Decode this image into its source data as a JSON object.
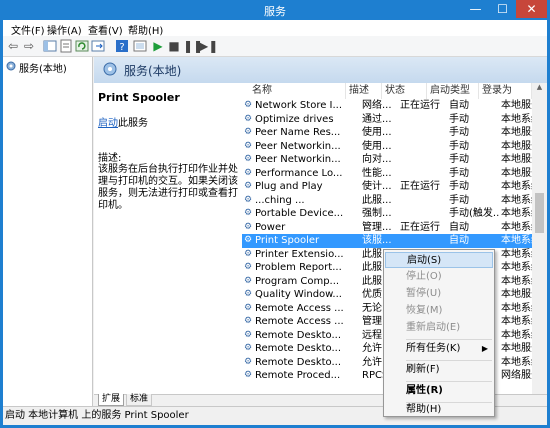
{
  "window": {
    "title": "服务",
    "minimize": "—",
    "maximize": "☐",
    "close": "✕"
  },
  "menubar": {
    "items": [
      "文件(F)",
      "操作(A)",
      "查看(V)",
      "帮助(H)"
    ]
  },
  "toolbar": {
    "icons": [
      "back-icon",
      "forward-icon",
      "console-tree-icon",
      "properties-icon",
      "refresh-icon",
      "export-icon",
      "help-icon",
      "console-icon",
      "play-icon",
      "stop-icon",
      "pause-icon",
      "resume-icon"
    ]
  },
  "tree": {
    "root": "服务(本地)"
  },
  "panel": {
    "header": "服务(本地)"
  },
  "details": {
    "service_name": "Print Spooler",
    "start_link": "启动",
    "start_suffix": "此服务",
    "desc_label": "描述:",
    "desc_text": "该服务在后台执行打印作业并处理与打印机的交互。如果关闭该服务，则无法进行打印或查看打印机。"
  },
  "columns": [
    "名称",
    "描述",
    "状态",
    "启动类型",
    "登录为"
  ],
  "rows": [
    [
      "Network Store I...",
      "网络...",
      "正在运行",
      "自动",
      "本地服务"
    ],
    [
      "Optimize drives",
      "通过...",
      "",
      "手动",
      "本地系统"
    ],
    [
      "Peer Name Res...",
      "使用...",
      "",
      "手动",
      "本地服务"
    ],
    [
      "Peer Networkin...",
      "使用...",
      "",
      "手动",
      "本地服务"
    ],
    [
      "Peer Networkin...",
      "向对...",
      "",
      "手动",
      "本地服务"
    ],
    [
      "Performance Lo...",
      "性能...",
      "",
      "手动",
      "本地服务"
    ],
    [
      "Plug and Play",
      "使计...",
      "正在运行",
      "手动",
      "本地系统"
    ],
    [
      "...ching ...",
      "此服...",
      "",
      "手动",
      "本地系统"
    ],
    [
      "Portable Device...",
      "强制...",
      "",
      "手动(触发...",
      "本地系统"
    ],
    [
      "Power",
      "管理...",
      "正在运行",
      "自动",
      "本地系统"
    ],
    [
      "Print Spooler",
      "该服...",
      "",
      "自动",
      "本地系统"
    ],
    [
      "Printer Extensio...",
      "此服...",
      "",
      "",
      "本地系统"
    ],
    [
      "Problem Report...",
      "此服...",
      "",
      "",
      "本地系统"
    ],
    [
      "Program Comp...",
      "此服...",
      "",
      "",
      "本地系统"
    ],
    [
      "Quality Window...",
      "优质...",
      "",
      "",
      "本地服务"
    ],
    [
      "Remote Access ...",
      "无论...",
      "",
      "",
      "本地系统"
    ],
    [
      "Remote Access ...",
      "管理...",
      "",
      "",
      "本地系统"
    ],
    [
      "Remote Deskto...",
      "远程...",
      "",
      "",
      "本地系统"
    ],
    [
      "Remote Deskto...",
      "允许...",
      "",
      "",
      "本地服务"
    ],
    [
      "Remote Deskto...",
      "允许...",
      "",
      "",
      "本地系统"
    ],
    [
      "Remote Proced...",
      "RPCS...",
      "",
      "",
      "网络服务"
    ]
  ],
  "selected_row": 10,
  "tabs": [
    "扩展",
    "标准"
  ],
  "status": "启动 本地计算机 上的服务 Print Spooler",
  "context_menu": {
    "start": "启动(S)",
    "stop": "停止(O)",
    "pause": "暂停(U)",
    "resume": "恢复(M)",
    "restart": "重新启动(E)",
    "all_tasks": "所有任务(K)",
    "refresh": "刷新(F)",
    "properties": "属性(R)",
    "help": "帮助(H)"
  },
  "colors": {
    "title_bar": "#1e7fd0",
    "selection": "#3399ff",
    "link": "#1a5fc0"
  }
}
